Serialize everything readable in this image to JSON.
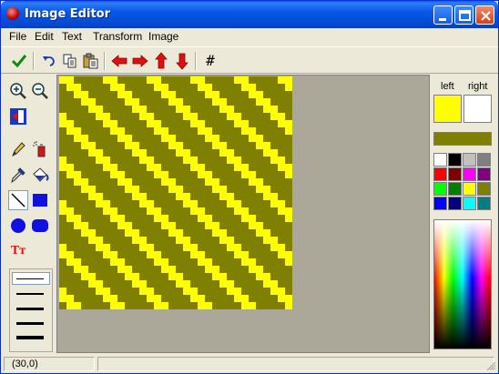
{
  "window": {
    "title": "Image Editor"
  },
  "menu": {
    "items": [
      "File",
      "Edit",
      "Text",
      "Transform",
      "Image"
    ]
  },
  "toolbar": {
    "icons": [
      "apply-check-icon",
      "undo-icon",
      "copy-icon",
      "paste-icon",
      "shift-left-icon",
      "shift-right-icon",
      "shift-up-icon",
      "shift-down-icon",
      "grid-icon"
    ],
    "grid_glyph": "#"
  },
  "tools": {
    "selected": "line-tool",
    "line_widths": [
      "1px",
      "2px",
      "3px",
      "4px",
      "5px"
    ],
    "text_tool_glyph": "Tт"
  },
  "colors": {
    "left_label": "left",
    "right_label": "right",
    "left_color": "#ffff00",
    "right_color": "#ffffff",
    "current_color": "#808000",
    "palette": [
      "#ffffff",
      "#000000",
      "#c0c0c0",
      "#808080",
      "#ff0000",
      "#800000",
      "#ff00ff",
      "#800080",
      "#00ff00",
      "#008000",
      "#ffff00",
      "#808000",
      "#0000ff",
      "#000080",
      "#00ffff",
      "#008080"
    ]
  },
  "image": {
    "background_color": "#808000",
    "stripe_color": "#ffff00"
  },
  "status": {
    "coordinates": "(30,0)"
  }
}
